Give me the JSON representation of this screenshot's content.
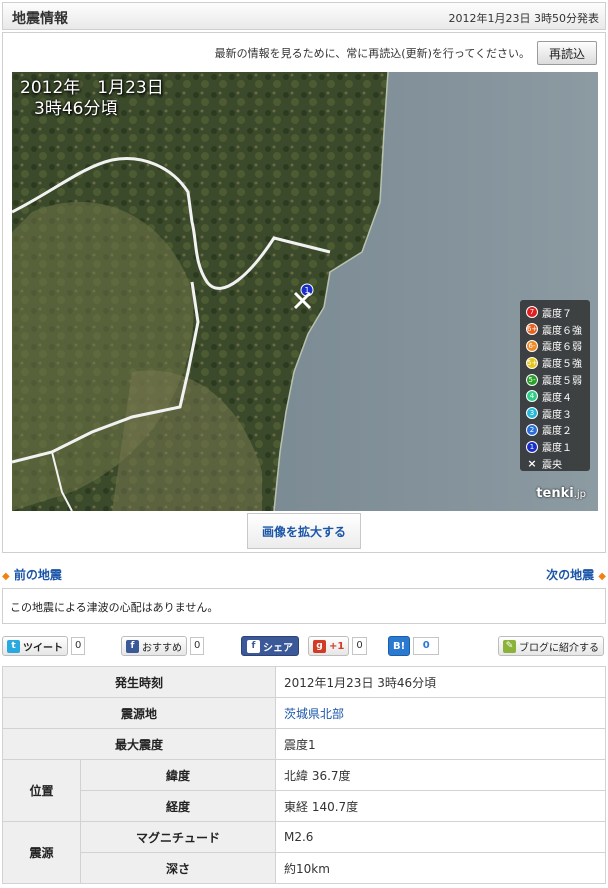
{
  "header": {
    "title": "地震情報",
    "published": "2012年1月23日 3時50分発表"
  },
  "refresh": {
    "note": "最新の情報を見るために、常に再読込(更新)を行ってください。",
    "button": "再読込"
  },
  "map": {
    "timestamp_line1": "2012年　1月23日",
    "timestamp_line2": "3時46分頃",
    "epicenter_badge": "1",
    "brand": "tenki",
    "brand_suffix": ".jp",
    "legend": [
      {
        "label": "震度７",
        "badge": "7",
        "color": "#e02020"
      },
      {
        "label": "震度６強",
        "badge": "6+",
        "color": "#e8601c"
      },
      {
        "label": "震度６弱",
        "badge": "6-",
        "color": "#f08a24"
      },
      {
        "label": "震度５強",
        "badge": "5+",
        "color": "#e6c41c"
      },
      {
        "label": "震度５弱",
        "badge": "5-",
        "color": "#2aa02a"
      },
      {
        "label": "震度４",
        "badge": "4",
        "color": "#2fcf8a"
      },
      {
        "label": "震度３",
        "badge": "3",
        "color": "#27b7d8"
      },
      {
        "label": "震度２",
        "badge": "2",
        "color": "#2a6fd8"
      },
      {
        "label": "震度１",
        "badge": "1",
        "color": "#1a2ec8"
      },
      {
        "label": "震央",
        "badge": "×",
        "color": ""
      }
    ],
    "enlarge_button": "画像を拡大する"
  },
  "nav": {
    "prev": "前の地震",
    "next": "次の地震"
  },
  "tsunami": "この地震による津波の心配はありません。",
  "social": {
    "tweet": "ツイート",
    "tweet_count": "0",
    "fb_recommend": "おすすめ",
    "fb_recommend_count": "0",
    "fb_share": "シェア",
    "gplus": "+1",
    "gplus_count": "0",
    "hatena": "B!",
    "hatena_count": "0",
    "blog": "ブログに紹介する"
  },
  "details": {
    "occurred_label": "発生時刻",
    "occurred_value": "2012年1月23日 3時46分頃",
    "epicenter_label": "震源地",
    "epicenter_value": "茨城県北部",
    "max_int_label": "最大震度",
    "max_int_value": "震度1",
    "position_label": "位置",
    "lat_label": "緯度",
    "lat_value": "北緯 36.7度",
    "lon_label": "経度",
    "lon_value": "東経 140.7度",
    "source_label": "震源",
    "mag_label": "マグニチュード",
    "mag_value": "M2.6",
    "depth_label": "深さ",
    "depth_value": "約10km"
  }
}
